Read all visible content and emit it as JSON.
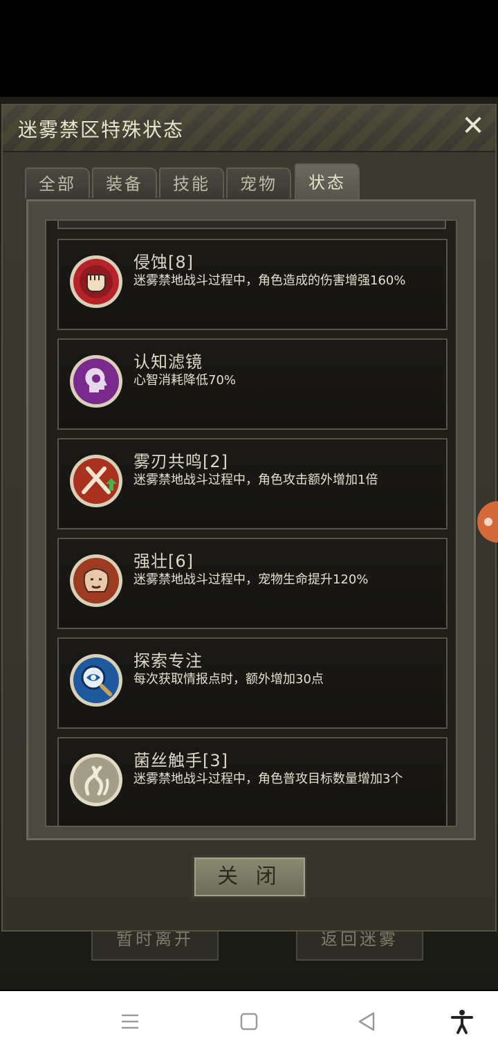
{
  "background": {
    "left_button": "暂时离开",
    "right_button": "返回迷雾"
  },
  "dialog": {
    "title": "迷雾禁区特殊状态",
    "close_symbol": "✕",
    "tabs": [
      {
        "label": "全部",
        "active": false
      },
      {
        "label": "装备",
        "active": false
      },
      {
        "label": "技能",
        "active": false
      },
      {
        "label": "宠物",
        "active": false
      },
      {
        "label": "状态",
        "active": true
      }
    ],
    "items": [
      {
        "name": "侵蚀[8]",
        "desc": "迷雾禁地战斗过程中，角色造成的伤害增强160%",
        "icon": "fist-icon",
        "color": "#b8232a"
      },
      {
        "name": "认知滤镜",
        "desc": "心智消耗降低70%",
        "icon": "head-silhouette-icon",
        "color": "#7a2a8c"
      },
      {
        "name": "雾刃共鸣[2]",
        "desc": "迷雾禁地战斗过程中，角色攻击额外增加1倍",
        "icon": "crossed-swords-icon",
        "color": "#a8321f"
      },
      {
        "name": "强壮[6]",
        "desc": "迷雾禁地战斗过程中，宠物生命提升120%",
        "icon": "beast-head-icon",
        "color": "#9c3a22"
      },
      {
        "name": "探索专注",
        "desc": "每次获取情报点时，额外增加30点",
        "icon": "eye-magnifier-icon",
        "color": "#1f5a9e"
      },
      {
        "name": "菌丝触手[3]",
        "desc": "迷雾禁地战斗过程中，角色普攻目标数量增加3个",
        "icon": "tentacles-icon",
        "color": "#a49e88"
      }
    ],
    "close_button": "关 闭"
  },
  "nav": {
    "icons": [
      "menu-icon",
      "home-square-icon",
      "back-triangle-icon",
      "accessibility-icon"
    ]
  }
}
